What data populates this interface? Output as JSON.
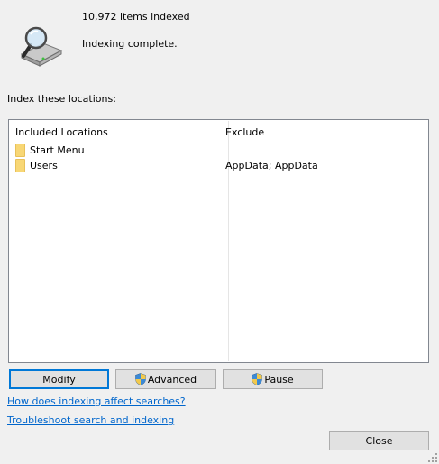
{
  "status": {
    "items_indexed": "10,972 items indexed",
    "message": "Indexing complete.",
    "icon": "drive-magnifier-icon"
  },
  "locations_heading": "Index these locations:",
  "table": {
    "headers": {
      "included": "Included Locations",
      "exclude": "Exclude"
    },
    "rows": [
      {
        "location": "Start Menu",
        "exclude": ""
      },
      {
        "location": "Users",
        "exclude": "AppData; AppData"
      }
    ]
  },
  "buttons": {
    "modify": "Modify",
    "advanced": "Advanced",
    "pause": "Pause",
    "close": "Close"
  },
  "links": {
    "how": "How does indexing affect searches?",
    "troubleshoot": "Troubleshoot search and indexing"
  },
  "colors": {
    "link": "#0066cc",
    "focus_border": "#0078d7",
    "folder": "#f8d775"
  }
}
